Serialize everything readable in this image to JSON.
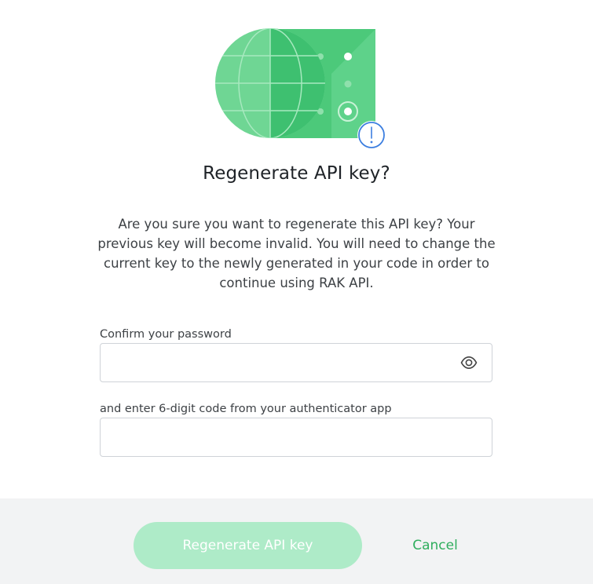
{
  "dialog": {
    "title": "Regenerate API key?",
    "description": "Are you sure you want to regenerate this API key? Your previous key will become invalid. You will need to change the current key to the newly generated in your code in order to continue using RAK API."
  },
  "form": {
    "password": {
      "label": "Confirm your password",
      "value": "",
      "placeholder": "",
      "toggle_icon": "eye-icon"
    },
    "code": {
      "label": "and enter 6-digit code from your authenticator app",
      "value": "",
      "placeholder": ""
    }
  },
  "actions": {
    "primary_label": "Regenerate API key",
    "cancel_label": "Cancel"
  },
  "illustration": {
    "icon": "globe-warning-icon",
    "badge_glyph": "!"
  },
  "colors": {
    "accent_green": "#2fae5d",
    "primary_button_disabled": "#aeebc8",
    "illustration_green": "#4cc97a",
    "badge_blue": "#3d7fe0",
    "footer_background": "#f2f3f4"
  }
}
